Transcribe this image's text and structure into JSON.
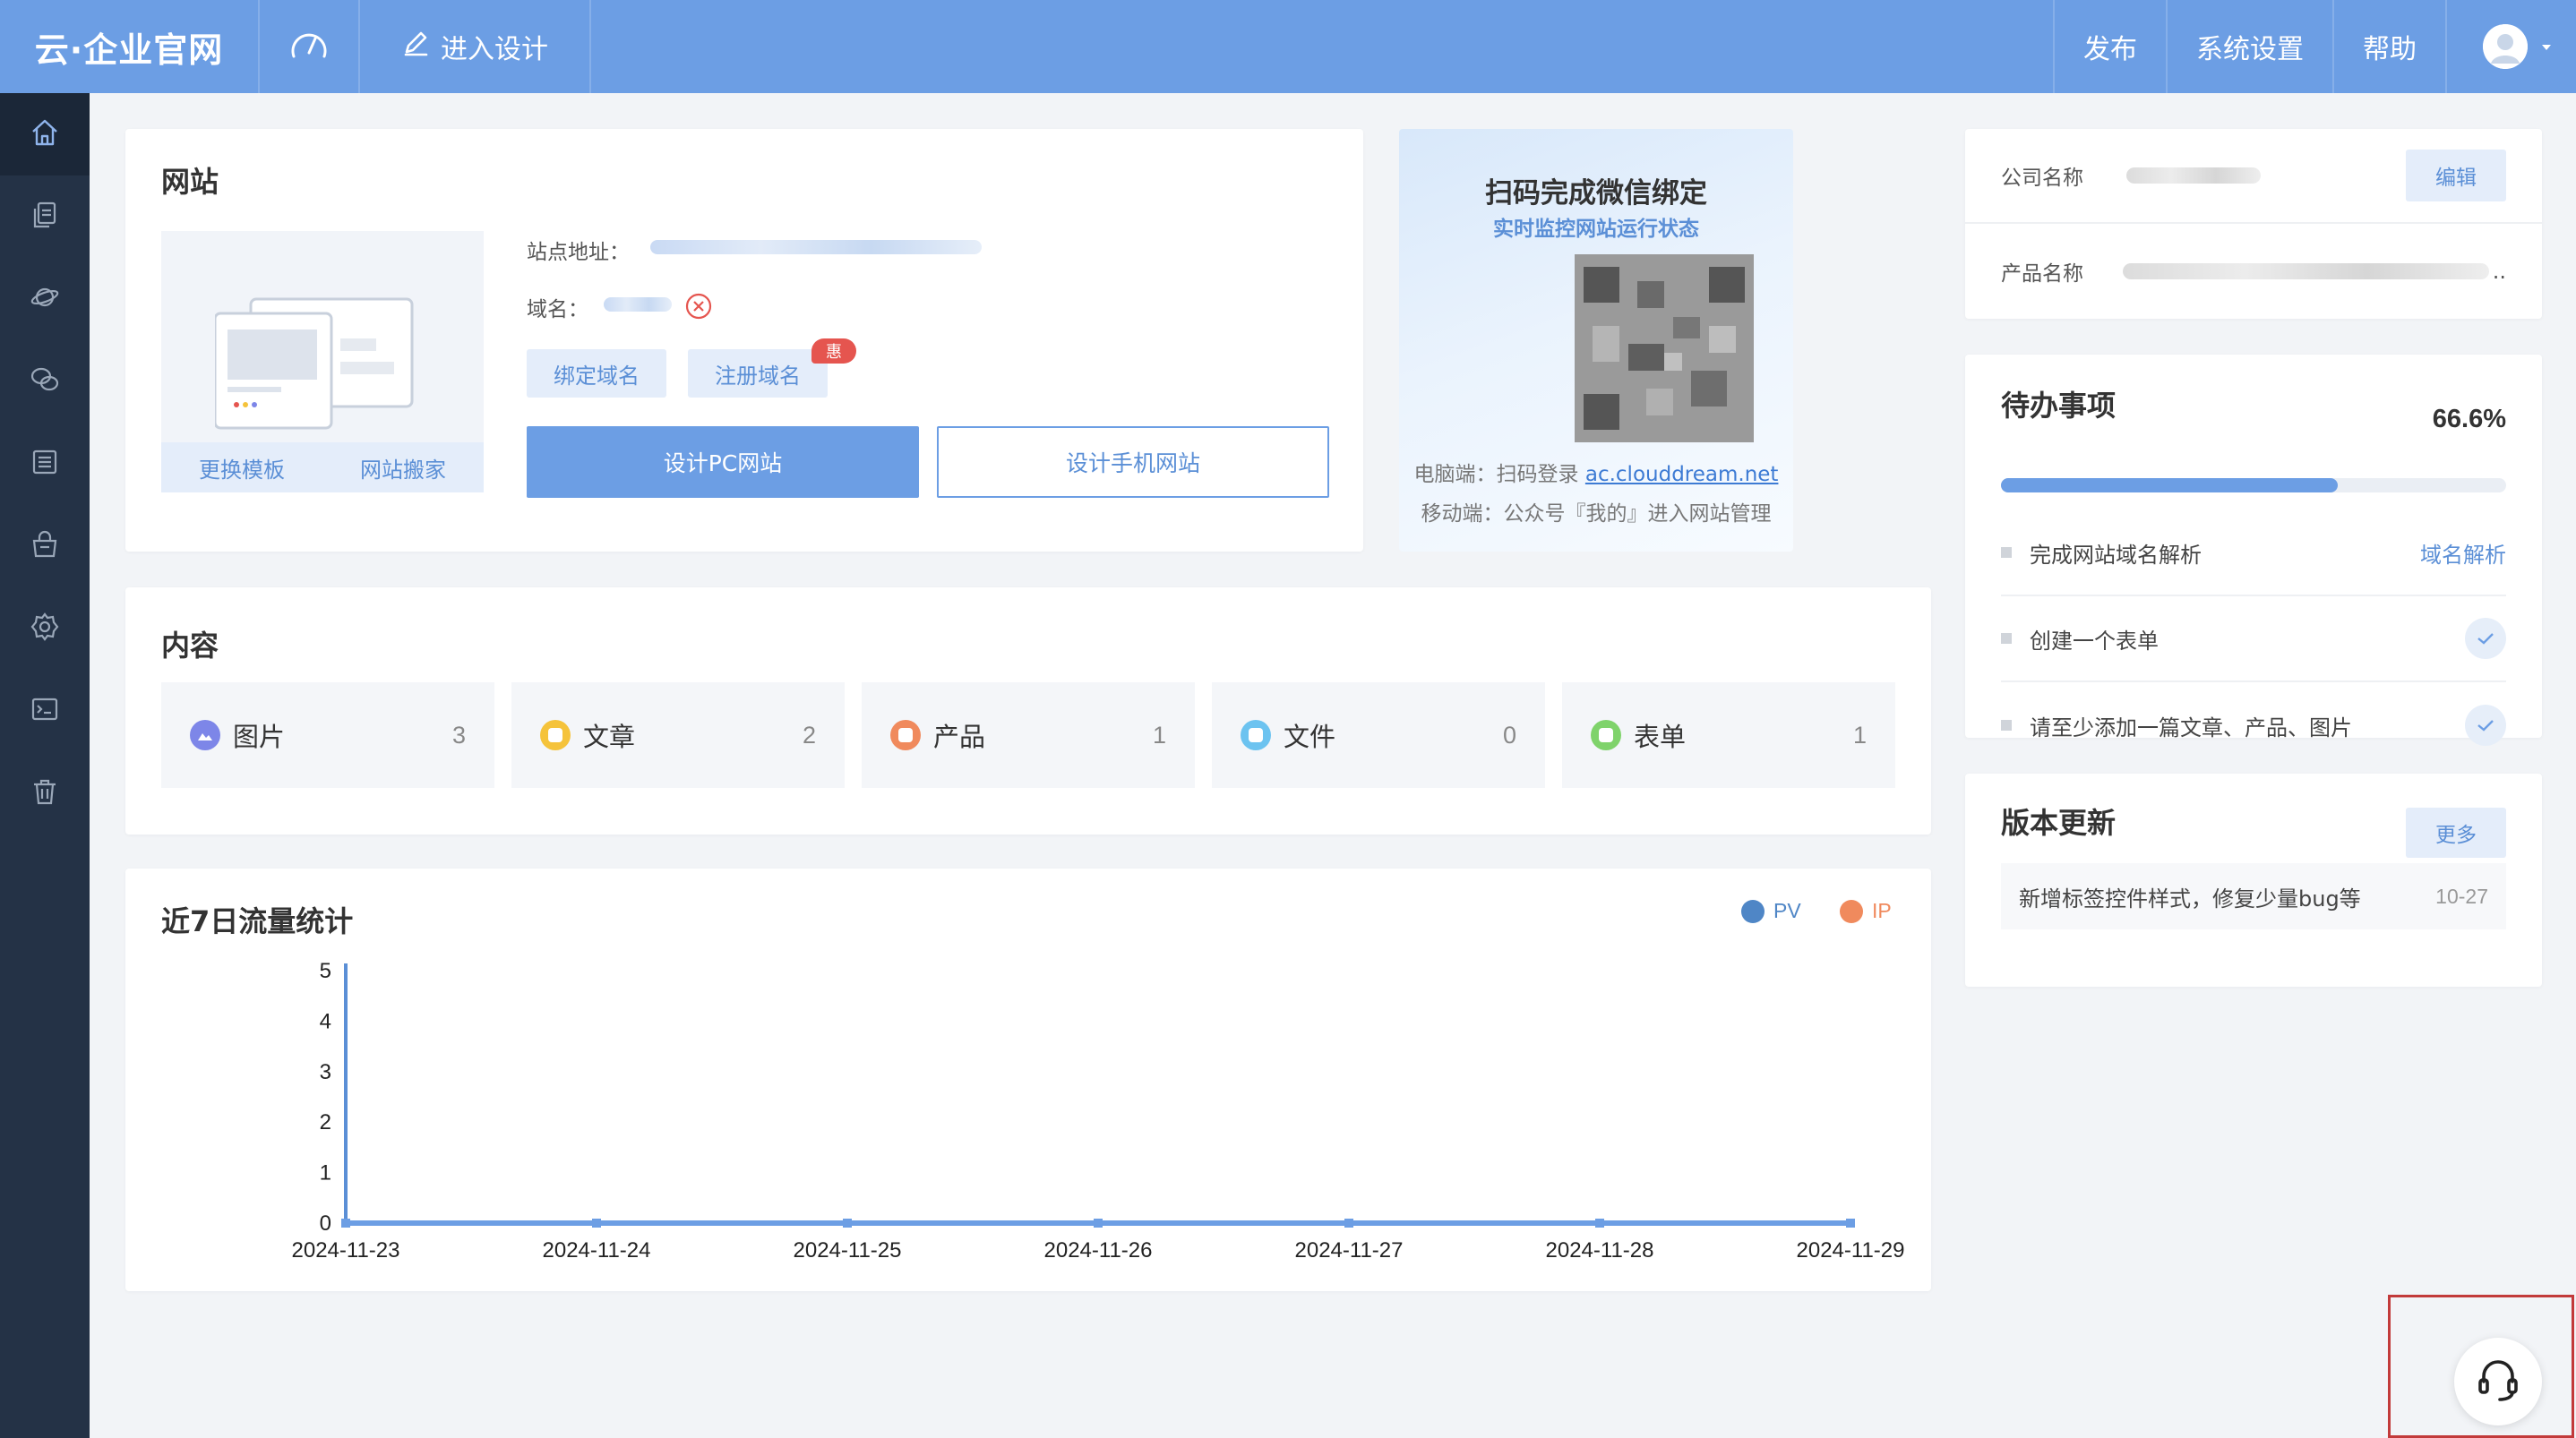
{
  "topbar": {
    "logo": "云·企业官网",
    "design_label": "进入设计",
    "publish": "发布",
    "settings": "系统设置",
    "help": "帮助"
  },
  "sidebar": {
    "items": [
      {
        "icon": "home-icon"
      },
      {
        "icon": "pages-icon"
      },
      {
        "icon": "planet-icon"
      },
      {
        "icon": "chat-icon"
      },
      {
        "icon": "list-icon"
      },
      {
        "icon": "shopping-bag-icon"
      },
      {
        "icon": "gear-icon"
      },
      {
        "icon": "terminal-icon"
      },
      {
        "icon": "trash-icon"
      }
    ]
  },
  "website": {
    "title": "网站",
    "change_template": "更换模板",
    "migrate": "网站搬家",
    "site_address_label": "站点地址：",
    "domain_label": "域名：",
    "bind_domain": "绑定域名",
    "register_domain": "注册域名",
    "promo_badge": "惠",
    "design_pc": "设计PC网站",
    "design_mobile": "设计手机网站"
  },
  "wechat": {
    "title": "扫码完成微信绑定",
    "subtitle": "实时监控网站运行状态",
    "pc_prefix": "电脑端：扫码登录 ",
    "pc_link": "ac.clouddream.net",
    "mobile_line": "移动端：公众号『我的』进入网站管理"
  },
  "info": {
    "company_label": "公司名称",
    "edit": "编辑",
    "product_label": "产品名称",
    "product_ellipsis": ".."
  },
  "content": {
    "title": "内容",
    "stats": [
      {
        "name": "图片",
        "value": "3",
        "color": "#7d86e8"
      },
      {
        "name": "文章",
        "value": "2",
        "color": "#f5c33b"
      },
      {
        "name": "产品",
        "value": "1",
        "color": "#f08a5d"
      },
      {
        "name": "文件",
        "value": "0",
        "color": "#6cc3f0"
      },
      {
        "name": "表单",
        "value": "1",
        "color": "#7fd36b"
      }
    ]
  },
  "todo": {
    "title": "待办事项",
    "percent_text": "66.6%",
    "progress": 0.666,
    "items": [
      {
        "text": "完成网站域名解析",
        "action": "域名解析"
      },
      {
        "text": "创建一个表单"
      },
      {
        "text": "请至少添加一篇文章、产品、图片"
      }
    ]
  },
  "version": {
    "title": "版本更新",
    "more": "更多",
    "update_text": "新增标签控件样式，修复少量bug等",
    "update_date": "10-27"
  },
  "traffic": {
    "title": "近7日流量统计"
  },
  "chart_data": {
    "type": "line",
    "title": "近7日流量统计",
    "x": [
      "2024-11-23",
      "2024-11-24",
      "2024-11-25",
      "2024-11-26",
      "2024-11-27",
      "2024-11-28",
      "2024-11-29"
    ],
    "y_ticks": [
      "0",
      "1",
      "2",
      "3",
      "4",
      "5"
    ],
    "ylim": [
      0,
      5
    ],
    "legend_position": "top-right",
    "series": [
      {
        "name": "PV",
        "color": "#4f86c6",
        "values": [
          0,
          0,
          0,
          0,
          0,
          0,
          0
        ]
      },
      {
        "name": "IP",
        "color": "#f08a5d",
        "values": [
          0,
          0,
          0,
          0,
          0,
          0,
          0
        ]
      }
    ]
  },
  "colors": {
    "accent": "#6c9ee4",
    "sidebar": "#243246",
    "link": "#5b8fd6"
  }
}
